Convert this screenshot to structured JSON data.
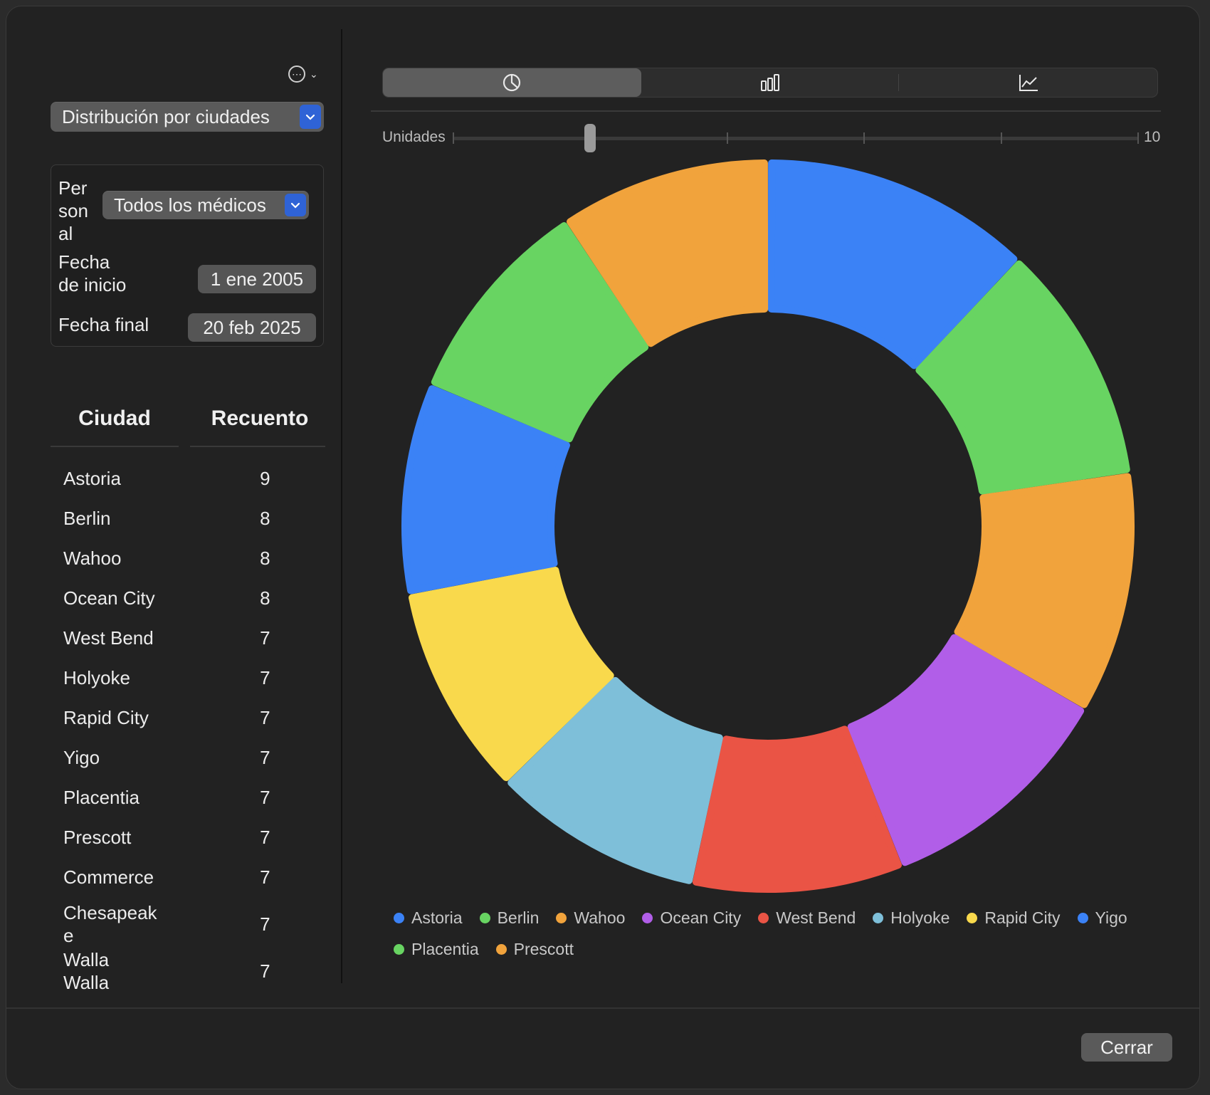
{
  "header": {
    "report_select": "Distribución por ciudades"
  },
  "filters": {
    "staff_label": "Personal",
    "staff_label_lines": [
      "Per",
      "son",
      "al"
    ],
    "staff_value": "Todos los médicos",
    "start_label": "Fecha de inicio",
    "start_label_lines": [
      "Fecha",
      "de inicio"
    ],
    "start_value": "1 ene 2005",
    "end_label": "Fecha final",
    "end_value": "20 feb 2025"
  },
  "table": {
    "col_city": "Ciudad",
    "col_count": "Recuento",
    "rows": [
      {
        "city": "Astoria",
        "count": "9"
      },
      {
        "city": "Berlin",
        "count": "8"
      },
      {
        "city": "Wahoo",
        "count": "8"
      },
      {
        "city": "Ocean City",
        "count": "8"
      },
      {
        "city": "West Bend",
        "count": "7"
      },
      {
        "city": "Holyoke",
        "count": "7"
      },
      {
        "city": "Rapid City",
        "count": "7"
      },
      {
        "city": "Yigo",
        "count": "7"
      },
      {
        "city": "Placentia",
        "count": "7"
      },
      {
        "city": "Prescott",
        "count": "7"
      },
      {
        "city": "Commerce",
        "count": "7"
      },
      {
        "city": "Chesapeake",
        "count": "7",
        "lines": [
          "Chesapeak",
          "e"
        ]
      },
      {
        "city": "Walla Walla",
        "count": "7"
      }
    ]
  },
  "chart_tabs": [
    {
      "icon": "pie-chart-icon",
      "active": true
    },
    {
      "icon": "bar-chart-icon",
      "active": false
    },
    {
      "icon": "line-chart-icon",
      "active": false
    }
  ],
  "slider": {
    "label": "Unidades",
    "max_label": "10",
    "value_fraction": 0.2
  },
  "chart_data": {
    "type": "pie",
    "variant": "donut",
    "categories": [
      "Astoria",
      "Berlin",
      "Wahoo",
      "Ocean City",
      "West Bend",
      "Holyoke",
      "Rapid City",
      "Yigo",
      "Placentia",
      "Prescott"
    ],
    "values": [
      9,
      8,
      8,
      8,
      7,
      7,
      7,
      7,
      7,
      7
    ],
    "colors": [
      "#3b82f6",
      "#68d462",
      "#f1a33c",
      "#b15ee8",
      "#ea5445",
      "#7ebfd9",
      "#f9d94c",
      "#3b82f6",
      "#68d462",
      "#f1a33c"
    ],
    "legend_position": "bottom",
    "title": ""
  },
  "footer": {
    "close_label": "Cerrar"
  }
}
